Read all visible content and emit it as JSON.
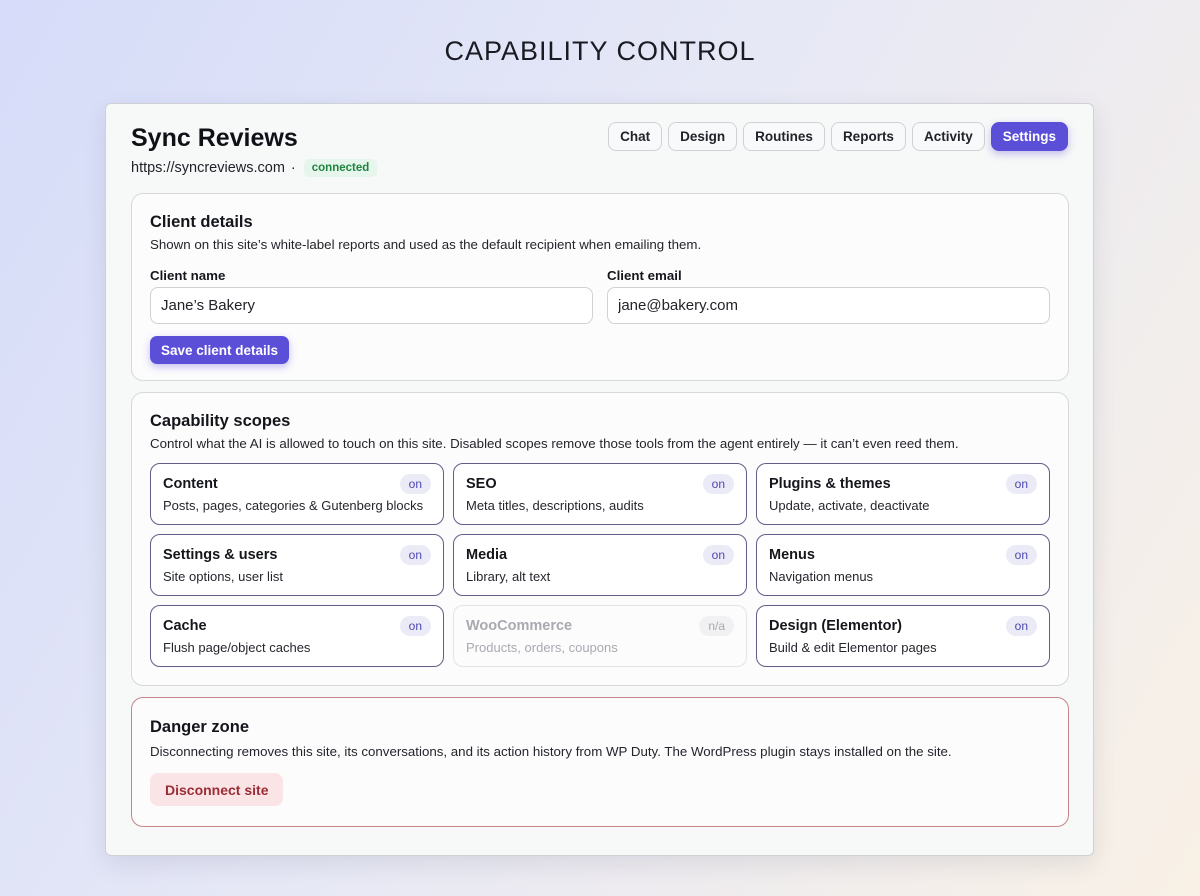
{
  "page_heading": "CAPABILITY CONTROL",
  "site": {
    "title": "Sync Reviews",
    "url": "https://syncreviews.com",
    "separator": "·",
    "status": "connected"
  },
  "tabs": [
    {
      "label": "Chat",
      "active": false
    },
    {
      "label": "Design",
      "active": false
    },
    {
      "label": "Routines",
      "active": false
    },
    {
      "label": "Reports",
      "active": false
    },
    {
      "label": "Activity",
      "active": false
    },
    {
      "label": "Settings",
      "active": true
    }
  ],
  "client_details": {
    "title": "Client details",
    "description": "Shown on this site’s white-label reports and used as the default recipient when emailing them.",
    "name_label": "Client name",
    "name_value": "Jane’s Bakery",
    "email_label": "Client email",
    "email_value": "jane@bakery.com",
    "save_label": "Save client details"
  },
  "capability_scopes": {
    "title": "Capability scopes",
    "description": "Control what the AI is allowed to touch on this site. Disabled scopes remove those tools from the agent entirely — it can’t even reed them.",
    "scopes": [
      {
        "name": "Content",
        "desc": "Posts, pages, categories & Gutenberg blocks",
        "state": "on"
      },
      {
        "name": "SEO",
        "desc": "Meta titles, descriptions, audits",
        "state": "on"
      },
      {
        "name": "Plugins & themes",
        "desc": "Update, activate, deactivate",
        "state": "on"
      },
      {
        "name": "Settings & users",
        "desc": "Site options, user list",
        "state": "on"
      },
      {
        "name": "Media",
        "desc": "Library, alt text",
        "state": "on"
      },
      {
        "name": "Menus",
        "desc": "Navigation menus",
        "state": "on"
      },
      {
        "name": "Cache",
        "desc": "Flush page/object caches",
        "state": "on"
      },
      {
        "name": "WooCommerce",
        "desc": "Products, orders, coupons",
        "state": "n/a"
      },
      {
        "name": "Design (Elementor)",
        "desc": "Build & edit Elementor pages",
        "state": "on"
      }
    ]
  },
  "danger_zone": {
    "title": "Danger zone",
    "description": "Disconnecting removes this site, its conversations, and its action history from WP Duty. The WordPress plugin stays installed on the site.",
    "button_label": "Disconnect site"
  },
  "colors": {
    "accent": "#5b4fd8",
    "connected": "#20843e",
    "danger": "#9c2d37"
  }
}
